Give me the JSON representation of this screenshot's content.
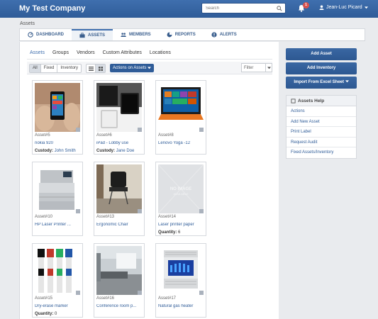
{
  "app": {
    "brand": "My Test Company"
  },
  "topbar": {
    "search_placeholder": "Search",
    "notification_count": "1",
    "user_name": "Jean-Luc Picard"
  },
  "breadcrumb": "Assets",
  "nav": {
    "tabs": [
      {
        "label": "DASHBOARD",
        "icon": "dashboard-icon"
      },
      {
        "label": "ASSETS",
        "icon": "briefcase-icon"
      },
      {
        "label": "MEMBERS",
        "icon": "users-icon"
      },
      {
        "label": "REPORTS",
        "icon": "pie-chart-icon"
      },
      {
        "label": "ALERTS",
        "icon": "alert-icon"
      }
    ],
    "active": "ASSETS"
  },
  "subtabs": [
    "Assets",
    "Groups",
    "Vendors",
    "Custom Attributes",
    "Locations"
  ],
  "toolbar": {
    "segments": [
      "All",
      "Fixed",
      "Inventory"
    ],
    "actions_label": "Actions on Assets",
    "filter_placeholder": "Filter"
  },
  "assets": [
    {
      "tag": "Asset#5",
      "name": "nokia 920",
      "meta_label": "Custody:",
      "meta_value": "John Smith",
      "image": "phone"
    },
    {
      "tag": "Asset#6",
      "name": "iPad - Lobby use",
      "meta_label": "Custody:",
      "meta_value": "Jane Doe",
      "image": "ipad"
    },
    {
      "tag": "Asset#8",
      "name": "Lenovo Yoga -12",
      "meta_label": "",
      "meta_value": "",
      "image": "laptop"
    },
    {
      "tag": "Asset#10",
      "name": "HP Laser Printer ...",
      "meta_label": "",
      "meta_value": "",
      "image": "printer"
    },
    {
      "tag": "Asset#13",
      "name": "Ergonomic Chair",
      "meta_label": "",
      "meta_value": "",
      "image": "chair"
    },
    {
      "tag": "Asset#14",
      "name": "Laser printer paper",
      "meta_label": "Quantity:",
      "meta_value": "6",
      "image": "noimage"
    },
    {
      "tag": "Asset#15",
      "name": "Dry-erase marker",
      "meta_label": "Quantity:",
      "meta_value": "0",
      "image": "markers"
    },
    {
      "tag": "Asset#16",
      "name": "Conference room p...",
      "meta_label": "",
      "meta_value": "",
      "image": "room"
    },
    {
      "tag": "Asset#17",
      "name": "Natural gas heater",
      "meta_label": "",
      "meta_value": "",
      "image": "heater"
    }
  ],
  "no_image_text": [
    "NO IMAGE",
    "AVAILABLE"
  ],
  "sidebar": {
    "buttons": [
      "Add Asset",
      "Add Inventory",
      "Import From Excel Sheet"
    ],
    "help_title": "Assets Help",
    "help_links": [
      "Actions",
      "Add New Asset",
      "Print Label",
      "Request Audit",
      "Fixed Assets/Inventory"
    ]
  }
}
